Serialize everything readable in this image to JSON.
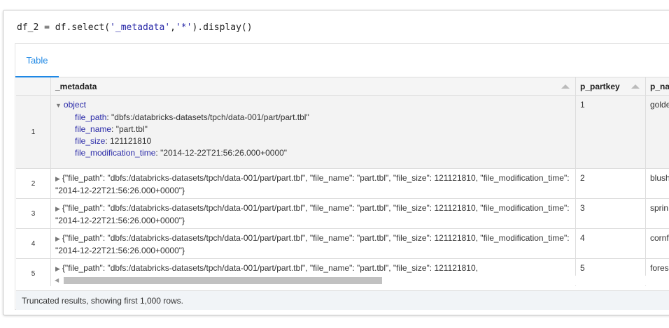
{
  "code": {
    "prefix": "df_2 = df.select(",
    "arg1": "'_metadata'",
    "comma": ",",
    "arg2": "'*'",
    "suffix": ").display()"
  },
  "tabs": [
    {
      "label": "Table"
    }
  ],
  "columns": [
    "_metadata",
    "p_partkey",
    "p_na"
  ],
  "expanded": {
    "label": "object",
    "fields": [
      {
        "key": "file_path",
        "value": "\"dbfs:/databricks-datasets/tpch/data-001/part/part.tbl\""
      },
      {
        "key": "file_name",
        "value": "\"part.tbl\""
      },
      {
        "key": "file_size",
        "value": "121121810"
      },
      {
        "key": "file_modification_time",
        "value": "\"2014-12-22T21:56:26.000+0000\""
      }
    ]
  },
  "rows": [
    {
      "index": "1",
      "metadata": "",
      "p_partkey": "1",
      "p_name": "golde"
    },
    {
      "index": "2",
      "metadata": "{\"file_path\": \"dbfs:/databricks-datasets/tpch/data-001/part/part.tbl\", \"file_name\": \"part.tbl\", \"file_size\": 121121810, \"file_modification_time\": \"2014-12-22T21:56:26.000+0000\"}",
      "p_partkey": "2",
      "p_name": "blush"
    },
    {
      "index": "3",
      "metadata": "{\"file_path\": \"dbfs:/databricks-datasets/tpch/data-001/part/part.tbl\", \"file_name\": \"part.tbl\", \"file_size\": 121121810, \"file_modification_time\": \"2014-12-22T21:56:26.000+0000\"}",
      "p_partkey": "3",
      "p_name": "sprin"
    },
    {
      "index": "4",
      "metadata": "{\"file_path\": \"dbfs:/databricks-datasets/tpch/data-001/part/part.tbl\", \"file_name\": \"part.tbl\", \"file_size\": 121121810, \"file_modification_time\": \"2014-12-22T21:56:26.000+0000\"}",
      "p_partkey": "4",
      "p_name": "cornf"
    },
    {
      "index": "5",
      "metadata": "{\"file_path\": \"dbfs:/databricks-datasets/tpch/data-001/part/part.tbl\", \"file_name\": \"part.tbl\", \"file_size\": 121121810,",
      "p_partkey": "5",
      "p_name": "fores"
    }
  ],
  "footer": "Truncated results, showing first 1,000 rows."
}
